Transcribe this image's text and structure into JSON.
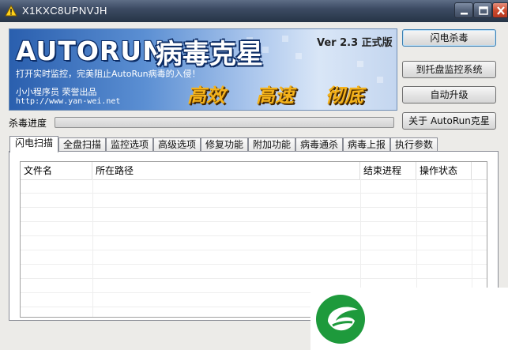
{
  "window": {
    "title": "X1KXC8UPNVJH"
  },
  "banner": {
    "logo": "AUTORUN",
    "title_cn": "病毒克星",
    "version": "Ver 2.3 正式版",
    "slogan": "打开实时监控，完美阻止AutoRun病毒的入侵！",
    "author": "小小程序员 荣誉出品",
    "website": "http://www.yan-wei.net",
    "features": [
      "高效",
      "高速",
      "彻底"
    ]
  },
  "buttons": {
    "scan": "闪电杀毒",
    "tray": "到托盘监控系统",
    "upgrade": "自动升级",
    "about": "关于 AutoRun克星"
  },
  "progress": {
    "label": "杀毒进度",
    "value": 0
  },
  "tabs": [
    "闪电扫描",
    "全盘扫描",
    "监控选项",
    "高级选项",
    "修复功能",
    "附加功能",
    "病毒通杀",
    "病毒上报",
    "执行参数"
  ],
  "active_tab": 0,
  "table": {
    "columns": [
      "文件名",
      "所在路径",
      "结束进程",
      "操作状态"
    ],
    "rows": []
  },
  "colors": {
    "brand_green": "#1e9a3c",
    "titlebar": "#3c4b63",
    "banner_blue": "#2a5fae",
    "feature_gold": "#f4b21a"
  },
  "icons": [
    "app-icon",
    "minimize-icon",
    "maximize-icon",
    "close-icon",
    "brand-leaf-logo-icon"
  ]
}
